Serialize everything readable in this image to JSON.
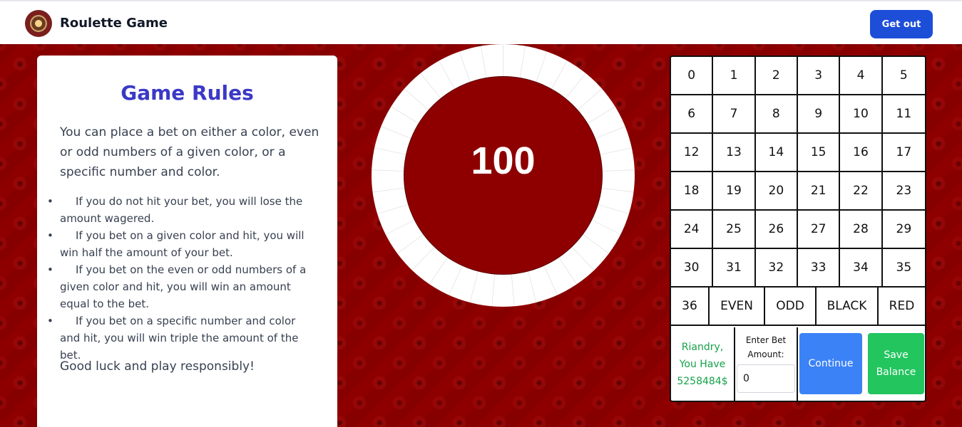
{
  "header": {
    "logo_icon": "roulette-wheel-icon",
    "title": "Roulette Game",
    "exit_label": "Get out"
  },
  "rules": {
    "title": "Game Rules",
    "intro": "You can place a bet on either a color, even or odd numbers of a given color, or a specific number and color.",
    "items": [
      "If you do not hit your bet, you will lose the amount wagered.",
      "If you bet on a given color and hit, you will win half the amount of your bet.",
      "If you bet on the even or odd numbers of a given color and hit, you will win an amount equal to the bet.",
      "If you bet on a specific number and color and hit, you will win triple the amount of the bet."
    ],
    "footer": "Good luck and play responsibly!"
  },
  "wheel": {
    "value": "100",
    "segments": 37
  },
  "board": {
    "numbers": [
      "0",
      "1",
      "2",
      "3",
      "4",
      "5",
      "6",
      "7",
      "8",
      "9",
      "10",
      "11",
      "12",
      "13",
      "14",
      "15",
      "16",
      "17",
      "18",
      "19",
      "20",
      "21",
      "22",
      "23",
      "24",
      "25",
      "26",
      "27",
      "28",
      "29",
      "30",
      "31",
      "32",
      "33",
      "34",
      "35"
    ],
    "bets": [
      "36",
      "EVEN",
      "ODD",
      "BLACK",
      "RED"
    ],
    "balance_lines": [
      "Riandry,",
      "You Have",
      "5258484$"
    ],
    "bet_label_lines": [
      "Enter Bet",
      "Amount:"
    ],
    "bet_amount": "0",
    "continue_label": "Continue",
    "save_label_lines": [
      "Save",
      "Balance"
    ]
  },
  "colors": {
    "accent": "#1d4ed8",
    "title": "#3b39c6",
    "felt": "#8e0000",
    "balance": "#16a34a",
    "continue": "#3b82f6",
    "save": "#22c55e"
  }
}
